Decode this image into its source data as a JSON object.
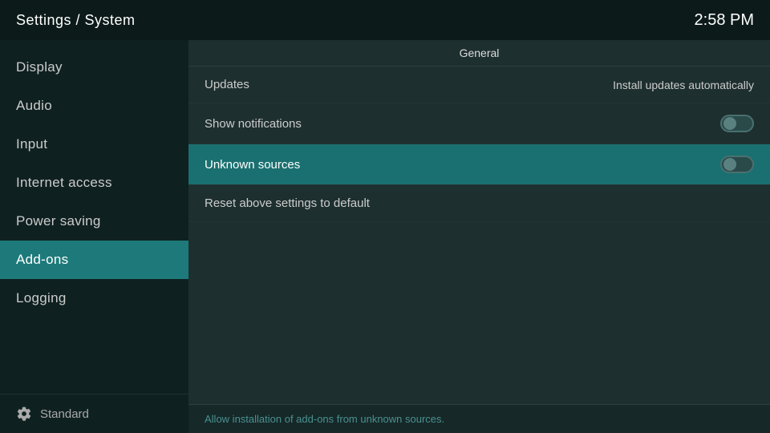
{
  "header": {
    "title": "Settings / System",
    "time": "2:58 PM"
  },
  "sidebar": {
    "items": [
      {
        "id": "display",
        "label": "Display",
        "active": false
      },
      {
        "id": "audio",
        "label": "Audio",
        "active": false
      },
      {
        "id": "input",
        "label": "Input",
        "active": false
      },
      {
        "id": "internet-access",
        "label": "Internet access",
        "active": false
      },
      {
        "id": "power-saving",
        "label": "Power saving",
        "active": false
      },
      {
        "id": "add-ons",
        "label": "Add-ons",
        "active": true
      },
      {
        "id": "logging",
        "label": "Logging",
        "active": false
      }
    ],
    "footer": {
      "icon": "gear-icon",
      "label": "Standard"
    }
  },
  "content": {
    "section_header": "General",
    "settings": [
      {
        "id": "updates",
        "label": "Updates",
        "value_text": "Install updates automatically",
        "toggle": null,
        "highlighted": false
      },
      {
        "id": "show-notifications",
        "label": "Show notifications",
        "value_text": null,
        "toggle": "off",
        "highlighted": false
      },
      {
        "id": "unknown-sources",
        "label": "Unknown sources",
        "value_text": null,
        "toggle": "off",
        "highlighted": true
      },
      {
        "id": "reset-settings",
        "label": "Reset above settings to default",
        "value_text": null,
        "toggle": null,
        "highlighted": false
      }
    ],
    "status_text": "Allow installation of add-ons from unknown sources."
  }
}
